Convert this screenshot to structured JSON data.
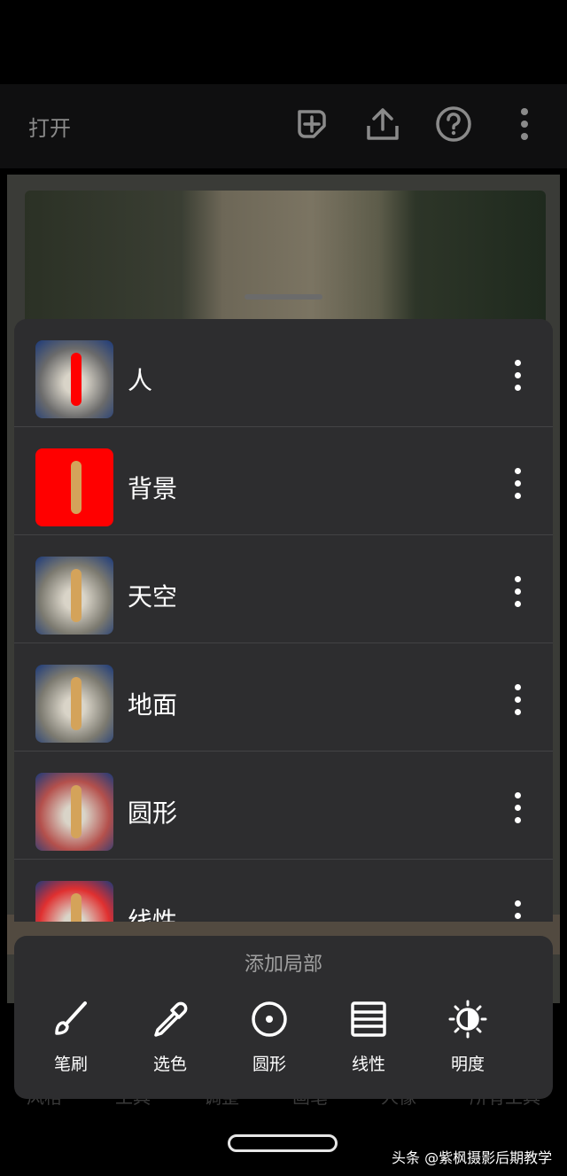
{
  "header": {
    "open_label": "打开",
    "icons": [
      "add-layer-icon",
      "share-icon",
      "help-icon",
      "more-vert-icon"
    ]
  },
  "background_nav_ghost": [
    "风格",
    "工具",
    "调整",
    "画笔",
    "人像",
    "所有工具"
  ],
  "masks": [
    {
      "label": "人",
      "thumb_bg": "#6b6b6b",
      "fig_color": "#ff0000"
    },
    {
      "label": "背景",
      "thumb_bg": "#ff0000",
      "fig_color": "#d4a35a"
    },
    {
      "label": "天空",
      "thumb_bg": "#7c7a70",
      "fig_color": "#d4a35a"
    },
    {
      "label": "地面",
      "thumb_bg": "#7c7a70",
      "fig_color": "#d4a35a"
    },
    {
      "label": "圆形",
      "thumb_bg": "#b4504c",
      "fig_color": "#d4a35a"
    },
    {
      "label": "线性",
      "thumb_bg": "#e03030",
      "fig_color": "#d4a35a"
    }
  ],
  "add_panel": {
    "title": "添加局部",
    "tools": [
      {
        "label": "笔刷",
        "icon": "brush-icon"
      },
      {
        "label": "选色",
        "icon": "eyedropper-icon"
      },
      {
        "label": "圆形",
        "icon": "radial-icon"
      },
      {
        "label": "线性",
        "icon": "linear-icon"
      },
      {
        "label": "明度",
        "icon": "luminance-icon"
      }
    ]
  },
  "watermark": "头条 @紫枫摄影后期教学",
  "colors": {
    "sheet": "#2d2d2f",
    "divider": "#434345",
    "accent_red": "#ff0000"
  }
}
